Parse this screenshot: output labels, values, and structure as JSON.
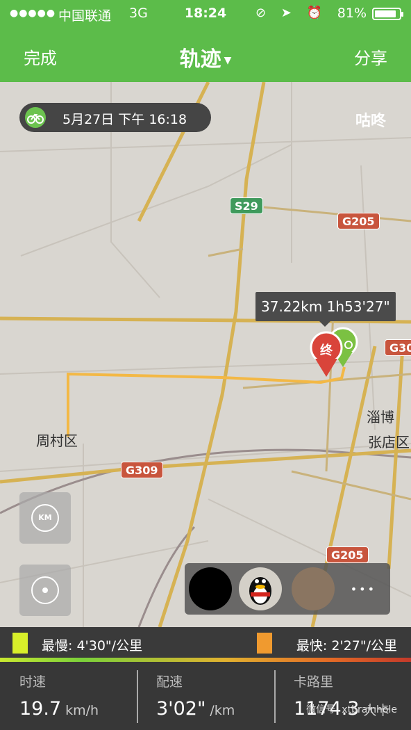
{
  "status_bar": {
    "signal": "●●●●●",
    "carrier": "中国联通",
    "network": "3G",
    "time": "18:24",
    "icons": "⊘ ➤ ⏰",
    "battery": "81%"
  },
  "nav": {
    "left": "完成",
    "title": "轨迹",
    "right": "分享"
  },
  "map": {
    "date": "5月27日 下午 16:18",
    "top_right_label": "咕咚",
    "tooltip": "37.22km 1h53'27\"",
    "end_marker": "终",
    "roads": [
      "S29",
      "G205",
      "G30",
      "G309",
      "G205"
    ],
    "places": [
      "淄博",
      "张店区",
      "周村区"
    ],
    "km_button": "KM"
  },
  "legend": {
    "slow": "最慢: 4'30\"/公里",
    "fast": "最快: 2'27\"/公里",
    "slow_color": "#d8ef2a",
    "fast_color": "#f09a2f"
  },
  "stats": [
    {
      "label": "时速",
      "value": "19.7",
      "unit": "km/h"
    },
    {
      "label": "配速",
      "value": "3'02\"",
      "unit": "/km"
    },
    {
      "label": "卡路里",
      "value": "1174.3",
      "unit": "大卡"
    }
  ],
  "watermark": "微信号: xtbrainhole"
}
